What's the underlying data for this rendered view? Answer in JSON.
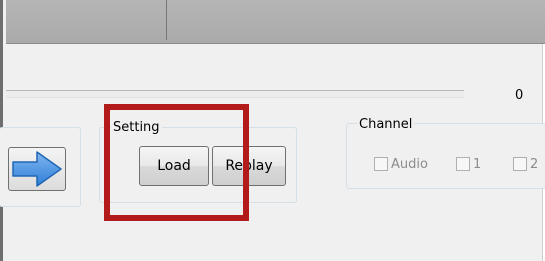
{
  "progress": {
    "value_label": "0"
  },
  "setting_group": {
    "title": "Setting",
    "load_label": "Load",
    "replay_label": "Replay"
  },
  "channel_group": {
    "title": "Channel",
    "checkboxes": [
      {
        "label": "Audio",
        "checked": false
      },
      {
        "label": "1",
        "checked": false
      },
      {
        "label": "2",
        "checked": false
      }
    ]
  },
  "navigation": {
    "next_icon": "arrow-right-icon"
  },
  "colors": {
    "highlight": "#b31b1b",
    "arrow": "#2f7fd8",
    "panel": "#f0f0f0"
  }
}
